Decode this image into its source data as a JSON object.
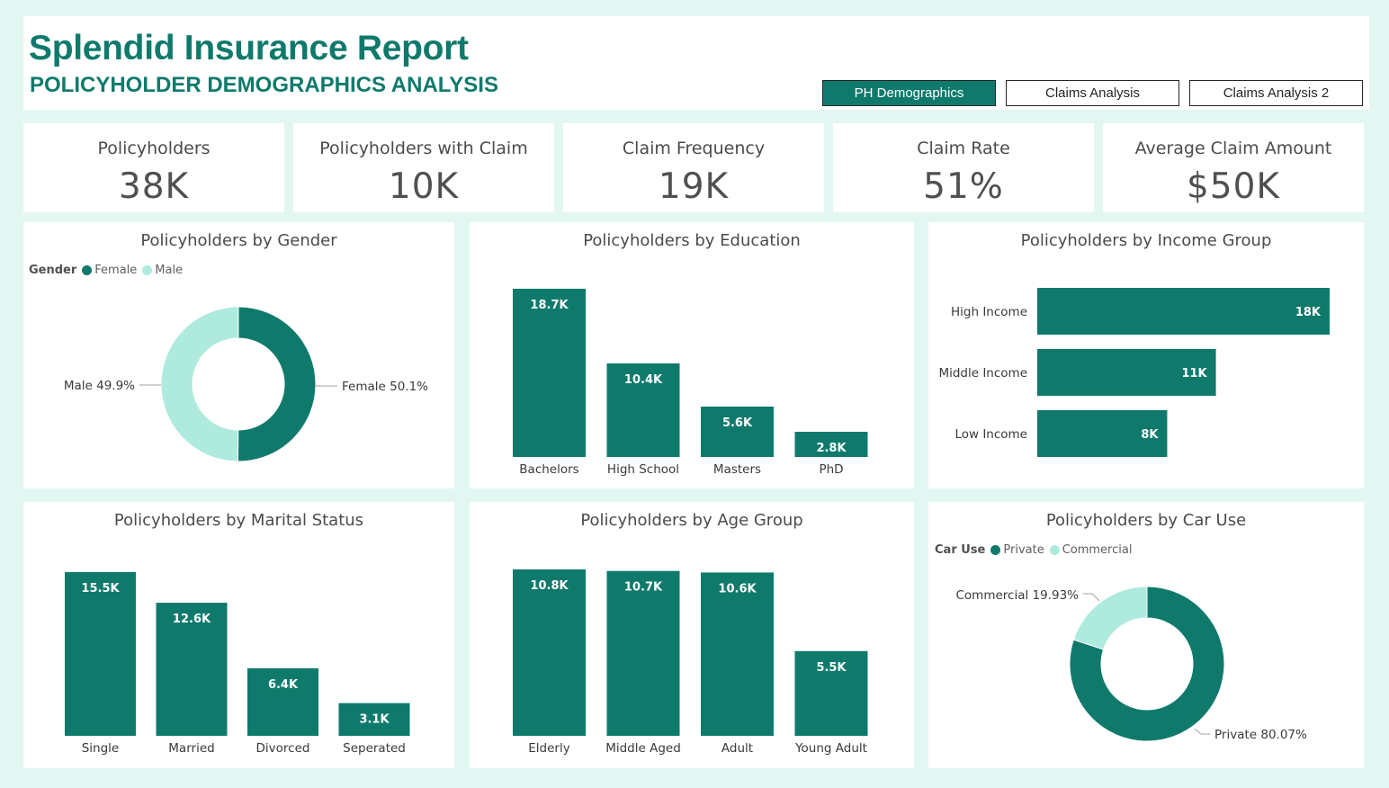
{
  "header": {
    "title": "Splendid Insurance Report",
    "subtitle": "POLICYHOLDER DEMOGRAPHICS ANALYSIS",
    "nav": [
      {
        "label": "PH Demographics",
        "active": true
      },
      {
        "label": "Claims Analysis",
        "active": false
      },
      {
        "label": "Claims Analysis 2",
        "active": false
      }
    ]
  },
  "cards": [
    {
      "label": "Policyholders",
      "value": "38K"
    },
    {
      "label": "Policyholders with Claim",
      "value": "10K"
    },
    {
      "label": "Claim Frequency",
      "value": "19K"
    },
    {
      "label": "Claim Rate",
      "value": "51%"
    },
    {
      "label": "Average Claim Amount",
      "value": "$50K"
    }
  ],
  "colors": {
    "primary": "#0f7a6c",
    "secondary": "#aeeadd",
    "title": "#0f7a6c",
    "background": "#e3f7f2"
  },
  "chart_data": [
    {
      "id": "gender",
      "type": "pie",
      "title": "Policyholders by Gender",
      "legend_title": "Gender",
      "legend_position": "top-left",
      "slices": [
        {
          "name": "Female",
          "value": 50.1,
          "label": "Female 50.1%",
          "color": "#0f7a6c"
        },
        {
          "name": "Male",
          "value": 49.9,
          "label": "Male 49.9%",
          "color": "#aeeadd"
        }
      ]
    },
    {
      "id": "education",
      "type": "bar",
      "title": "Policyholders by Education",
      "categories": [
        "Bachelors",
        "High School",
        "Masters",
        "PhD"
      ],
      "values": [
        18.7,
        10.4,
        5.6,
        2.8
      ],
      "labels": [
        "18.7K",
        "10.4K",
        "5.6K",
        "2.8K"
      ],
      "ylim": [
        0,
        18.7
      ]
    },
    {
      "id": "income",
      "type": "bar",
      "orientation": "horizontal",
      "title": "Policyholders by Income Group",
      "categories": [
        "High Income",
        "Middle Income",
        "Low Income"
      ],
      "values": [
        18,
        11,
        8
      ],
      "labels": [
        "18K",
        "11K",
        "8K"
      ],
      "xlim": [
        0,
        18
      ]
    },
    {
      "id": "marital",
      "type": "bar",
      "title": "Policyholders by Marital Status",
      "categories": [
        "Single",
        "Married",
        "Divorced",
        "Seperated"
      ],
      "values": [
        15.5,
        12.6,
        6.4,
        3.1
      ],
      "labels": [
        "15.5K",
        "12.6K",
        "6.4K",
        "3.1K"
      ],
      "ylim": [
        0,
        15.5
      ]
    },
    {
      "id": "age",
      "type": "bar",
      "title": "Policyholders by Age Group",
      "categories": [
        "Elderly",
        "Middle Aged",
        "Adult",
        "Young Adult"
      ],
      "values": [
        10.8,
        10.7,
        10.6,
        5.5
      ],
      "labels": [
        "10.8K",
        "10.7K",
        "10.6K",
        "5.5K"
      ],
      "ylim": [
        0,
        10.8
      ]
    },
    {
      "id": "caruse",
      "type": "pie",
      "title": "Policyholders by Car Use",
      "legend_title": "Car Use",
      "legend_position": "top-left",
      "slices": [
        {
          "name": "Private",
          "value": 80.07,
          "label": "Private 80.07%",
          "color": "#0f7a6c"
        },
        {
          "name": "Commercial",
          "value": 19.93,
          "label": "Commercial 19.93%",
          "color": "#aeeadd"
        }
      ]
    }
  ]
}
